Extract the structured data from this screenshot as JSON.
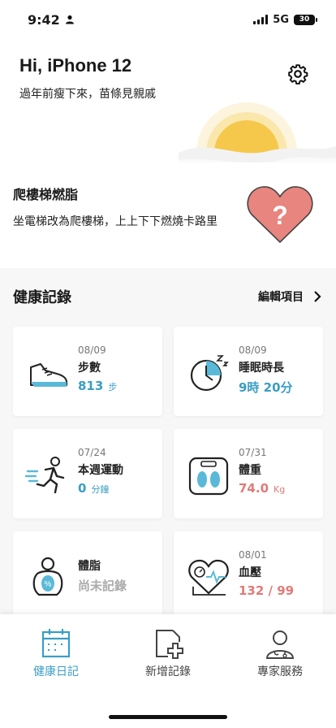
{
  "status": {
    "time": "9:42",
    "network": "5G",
    "battery": "30"
  },
  "header": {
    "greeting": "Hi, iPhone 12",
    "subtitle": "過年前瘦下來，苗條見親戚"
  },
  "tip": {
    "title": "爬樓梯燃脂",
    "text": "坐電梯改為爬樓梯，上上下下燃燒卡路里"
  },
  "records": {
    "title": "健康記錄",
    "edit_label": "編輯項目",
    "cards": [
      {
        "date": "08/09",
        "label": "步數",
        "value": "813",
        "unit": "步",
        "icon": "shoe-icon"
      },
      {
        "date": "08/09",
        "label": "睡眠時長",
        "value": "9時 20分",
        "unit": "",
        "icon": "sleep-clock-icon"
      },
      {
        "date": "07/24",
        "label": "本週運動",
        "value": "0",
        "unit": "分鐘",
        "icon": "running-icon"
      },
      {
        "date": "07/31",
        "label": "體重",
        "value": "74.0",
        "unit": "Kg",
        "icon": "scale-icon"
      },
      {
        "date": "",
        "label": "體脂",
        "value": "尚未記錄",
        "unit": "",
        "icon": "body-fat-icon"
      },
      {
        "date": "08/01",
        "label": "血壓",
        "value": "132 / 99",
        "unit": "",
        "icon": "blood-pressure-icon"
      }
    ]
  },
  "nav": {
    "items": [
      {
        "label": "健康日記",
        "icon": "calendar-icon"
      },
      {
        "label": "新增記錄",
        "icon": "add-record-icon"
      },
      {
        "label": "專家服務",
        "icon": "doctor-icon"
      }
    ]
  },
  "colors": {
    "accent": "#3a9ec4",
    "warning": "#e07b78",
    "sun": "#f5c84c"
  }
}
